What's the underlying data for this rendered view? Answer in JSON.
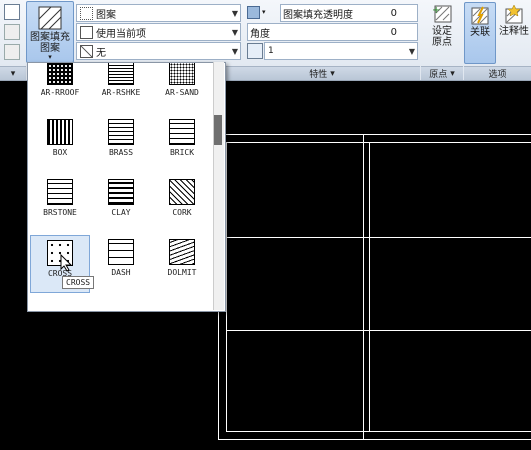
{
  "ribbon": {
    "hatch_button_label": "图案填充\n图案",
    "pattern_type": "图案",
    "color_value": "使用当前项",
    "background_value": "无",
    "transparency_label": "图案填充透明度",
    "transparency_value": "0",
    "angle_label": "角度",
    "angle_value": "0",
    "scale_value": "1",
    "set_origin_label": "设定\n原点",
    "associative_label": "关联",
    "annotative_label": "注释性",
    "panel_properties": "特性",
    "panel_origin": "原点",
    "panel_options": "选项"
  },
  "gallery": {
    "rows": [
      [
        {
          "name": "AR-RROOF",
          "pattern": "dots"
        },
        {
          "name": "AR-RSHKE",
          "pattern": "brick-small"
        },
        {
          "name": "AR-SAND",
          "pattern": "sand"
        }
      ],
      [
        {
          "name": "BOX",
          "pattern": "box"
        },
        {
          "name": "BRASS",
          "pattern": "lines"
        },
        {
          "name": "BRICK",
          "pattern": "brick"
        }
      ],
      [
        {
          "name": "BRSTONE",
          "pattern": "brick"
        },
        {
          "name": "CLAY",
          "pattern": "lines-thick"
        },
        {
          "name": "CORK",
          "pattern": "diag"
        }
      ],
      [
        {
          "name": "CROSS",
          "pattern": "cross"
        },
        {
          "name": "DASH",
          "pattern": "dash"
        },
        {
          "name": "DOLMIT",
          "pattern": "dolmit"
        }
      ]
    ],
    "selected": "CROSS",
    "tooltip": "CROSS"
  }
}
